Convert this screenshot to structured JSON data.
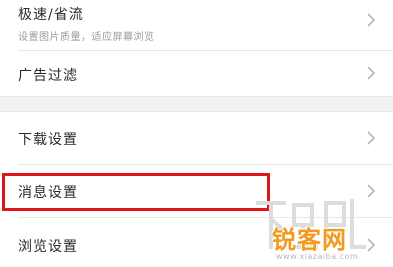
{
  "settings": {
    "items": [
      {
        "label": "极速/省流",
        "subtitle": "设置图片质量，适应屏幕浏览"
      },
      {
        "label": "广告过滤"
      },
      {
        "label": "下载设置"
      },
      {
        "label": "消息设置"
      },
      {
        "label": "浏览设置"
      }
    ]
  },
  "icons": {
    "row_arrow": "chevron-right-icon"
  },
  "highlight": {
    "color": "#e0141c",
    "target": "消息设置"
  },
  "watermark": {
    "brand": "锐客网",
    "url": "www.xiazaiba.com",
    "color": "#f29a1e"
  }
}
